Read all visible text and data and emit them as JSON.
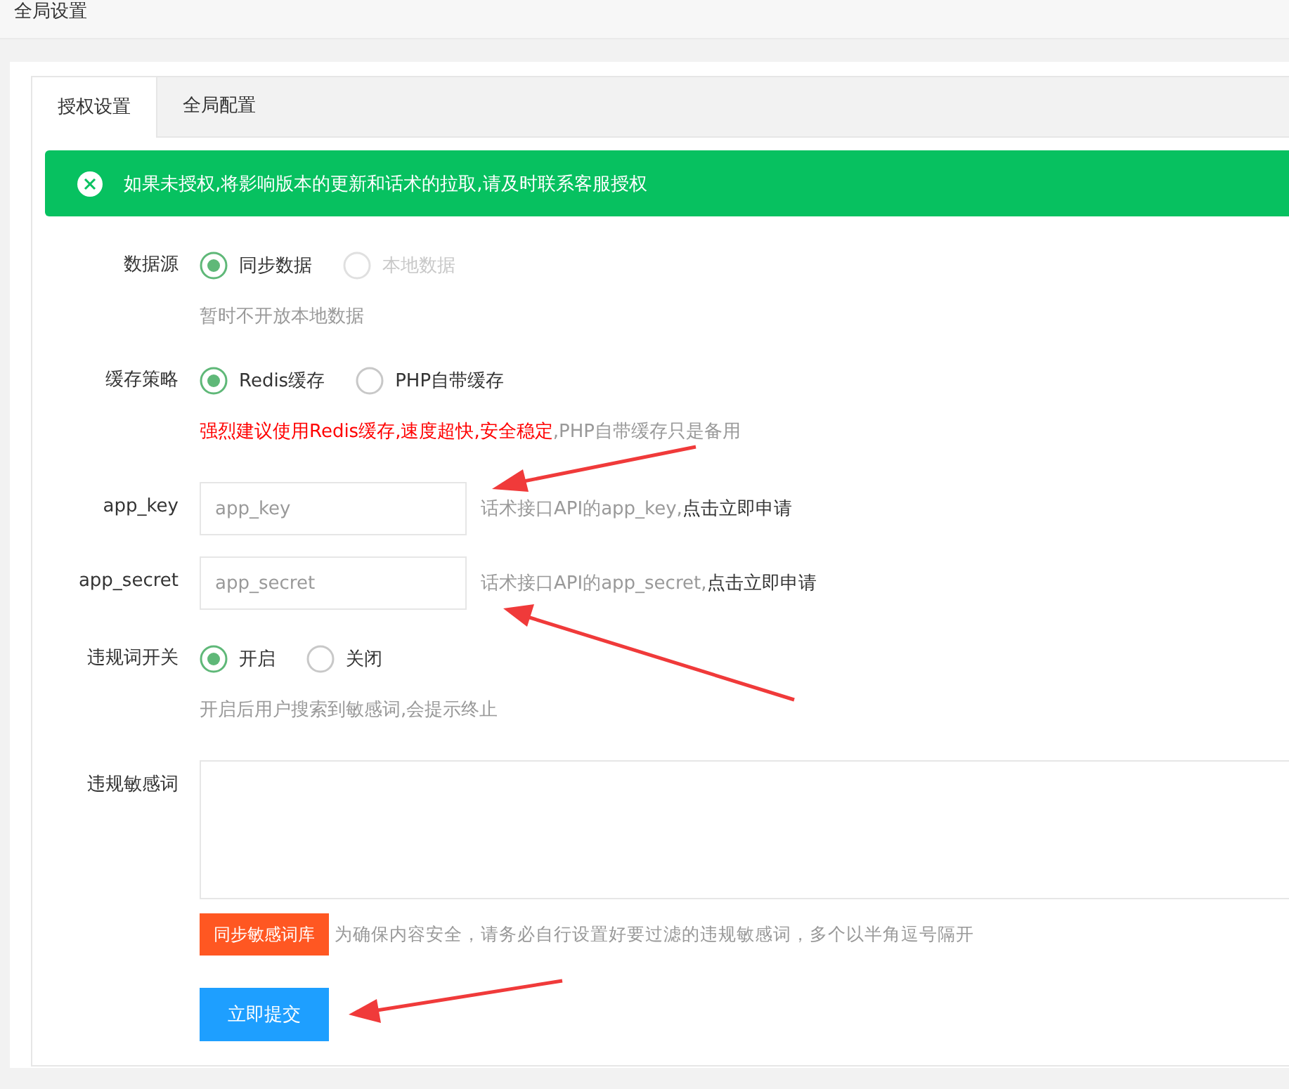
{
  "header": {
    "title": "全局设置"
  },
  "tabs": [
    {
      "label": "授权设置",
      "selected": true
    },
    {
      "label": "全局配置",
      "selected": false
    }
  ],
  "alert": {
    "text": "如果未授权,将影响版本的更新和话术的拉取,请及时联系客服授权"
  },
  "fields": [
    {
      "kind": "radio",
      "label": "数据源",
      "options": [
        {
          "label": "同步数据",
          "selected": true,
          "disabled": false
        },
        {
          "label": "本地数据",
          "selected": false,
          "disabled": true
        }
      ],
      "hint": [
        {
          "text": "暂时不开放本地数据",
          "emphasis": false
        }
      ]
    },
    {
      "kind": "radio",
      "label": "缓存策略",
      "options": [
        {
          "label": "Redis缓存",
          "selected": true,
          "disabled": false
        },
        {
          "label": "PHP自带缓存",
          "selected": false,
          "disabled": false
        }
      ],
      "hint": [
        {
          "text": "强烈建议使用Redis缓存,速度超快,安全稳定",
          "emphasis": true
        },
        {
          "text": ",PHP自带缓存只是备用",
          "emphasis": false
        }
      ]
    },
    {
      "kind": "input",
      "label": "app_key",
      "placeholder": "app_key",
      "aside": "话术接口API的app_key,",
      "link": "点击立即申请"
    },
    {
      "kind": "input",
      "label": "app_secret",
      "placeholder": "app_secret",
      "aside": "话术接口API的app_secret,",
      "link": "点击立即申请"
    },
    {
      "kind": "radio",
      "label": "违规词开关",
      "options": [
        {
          "label": "开启",
          "selected": true,
          "disabled": false
        },
        {
          "label": "关闭",
          "selected": false,
          "disabled": false
        }
      ],
      "hint": [
        {
          "text": "开启后用户搜索到敏感词,会提示终止",
          "emphasis": false
        }
      ]
    },
    {
      "kind": "textarea",
      "label": "违规敏感词",
      "button": "同步敏感词库",
      "aside": "为确保内容安全，请务必自行设置好要过滤的违规敏感词，多个以半角逗号隔开"
    }
  ],
  "submit": "立即提交"
}
